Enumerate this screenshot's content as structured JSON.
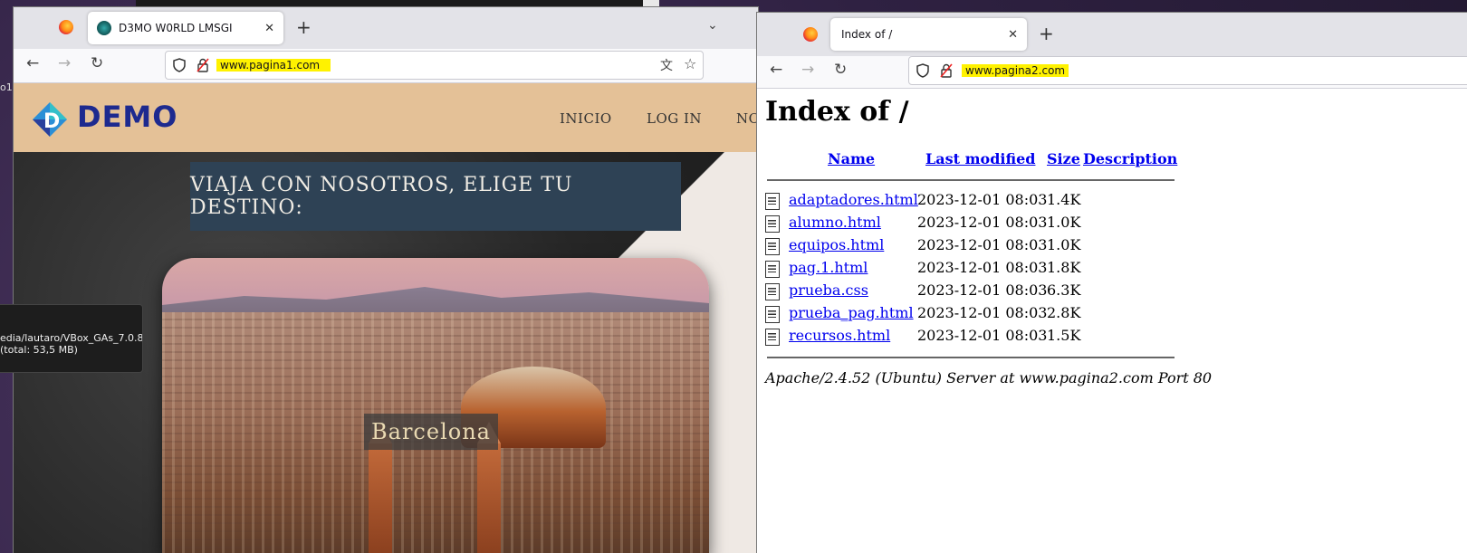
{
  "desktop": {
    "side_char": "o1"
  },
  "tooltip": {
    "line1": "edia/lautaro/VBox_GAs_7.0.8",
    "line2": "(total: 53,5 MB)"
  },
  "window1": {
    "tab_title": "D3MO W0RLD LMSGI",
    "url": "www.pagina1.com",
    "site": {
      "logo_text": "DEMO",
      "menu": [
        "INICIO",
        "LOG IN",
        "NO"
      ],
      "banner": "VIAJA CON NOSOTROS, ELIGE TU DESTINO:",
      "caption": "Barcelona"
    }
  },
  "window2": {
    "tab_title": "Index of /",
    "url": "www.pagina2.com",
    "page_title": "Index of /",
    "columns": {
      "name": "Name",
      "modified": "Last modified",
      "size": "Size",
      "description": "Description"
    },
    "files": [
      {
        "name": "adaptadores.html",
        "modified": "2023-12-01 08:03",
        "size": "1.4K"
      },
      {
        "name": "alumno.html",
        "modified": "2023-12-01 08:03",
        "size": "1.0K"
      },
      {
        "name": "equipos.html",
        "modified": "2023-12-01 08:03",
        "size": "1.0K"
      },
      {
        "name": "pag.1.html",
        "modified": "2023-12-01 08:03",
        "size": "1.8K"
      },
      {
        "name": "prueba.css",
        "modified": "2023-12-01 08:03",
        "size": "6.3K"
      },
      {
        "name": "prueba_pag.html",
        "modified": "2023-12-01 08:03",
        "size": "2.8K"
      },
      {
        "name": "recursos.html",
        "modified": "2023-12-01 08:03",
        "size": "1.5K"
      }
    ],
    "footer": "Apache/2.4.52 (Ubuntu) Server at www.pagina2.com Port 80"
  }
}
